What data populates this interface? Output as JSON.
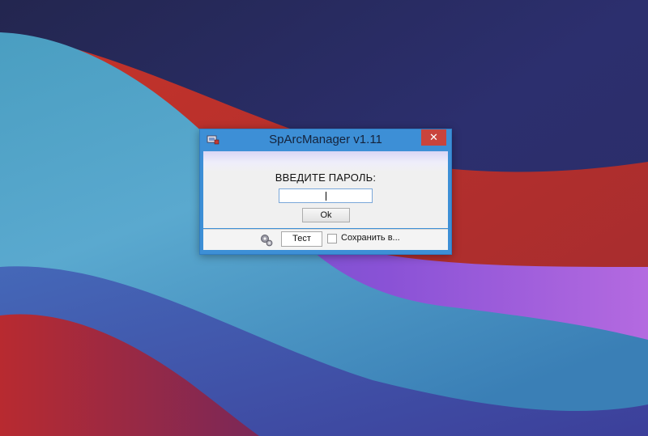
{
  "window": {
    "title": "SpArcManager v1.11",
    "close_symbol": "✕",
    "app_icon": "computer-lock-icon"
  },
  "login": {
    "prompt": "ВВЕДИТЕ ПАРОЛЬ:",
    "password_value": "",
    "ok_label": "Ok"
  },
  "footer": {
    "settings_icon": "gears-icon",
    "test_label": "Тест",
    "save_label": "Сохранить в...",
    "save_checked": false
  },
  "colors": {
    "title_bar": "#3d8fd6",
    "close_button": "#c9443d",
    "input_border": "#7aa7d9"
  }
}
